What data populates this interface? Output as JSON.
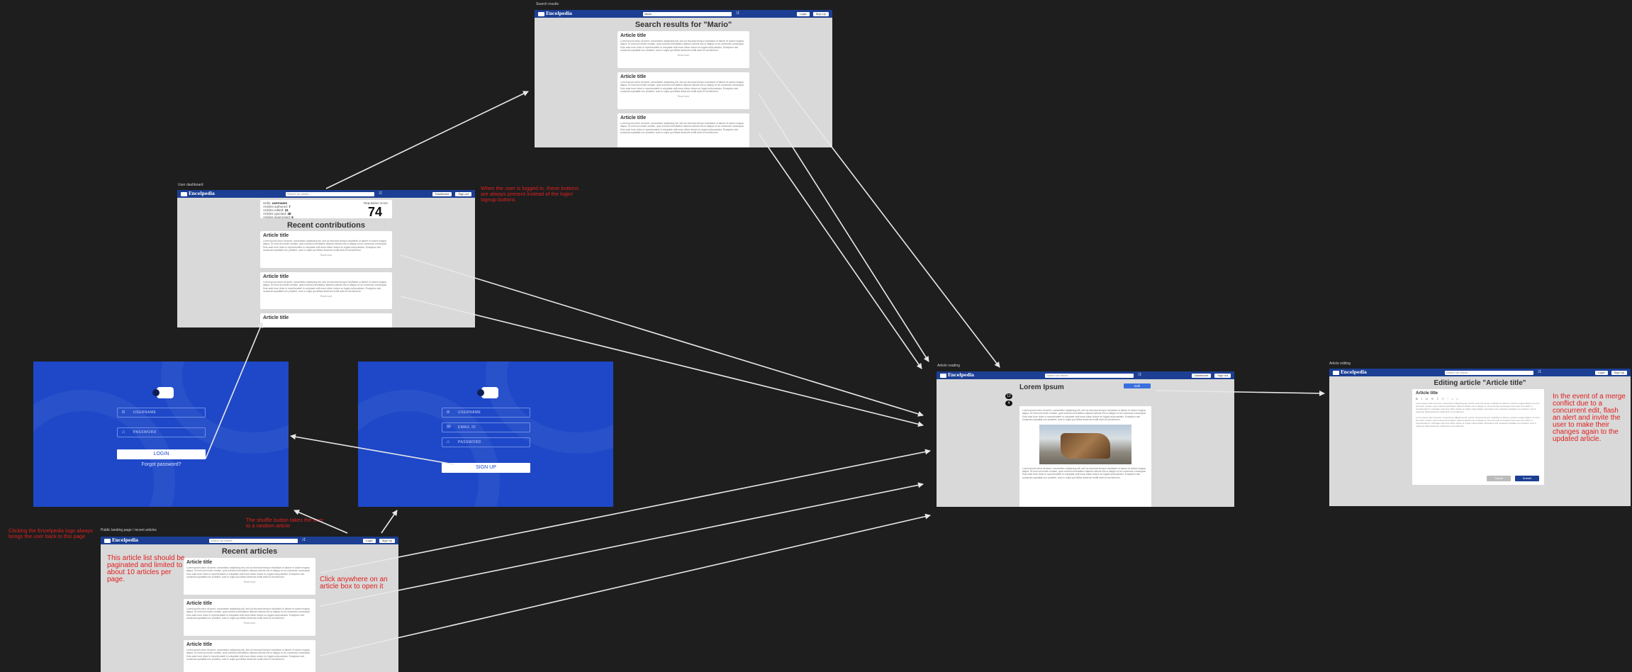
{
  "app": {
    "brand": "Encelpedia"
  },
  "frames": {
    "search": {
      "label": "Search results",
      "nav": {
        "search_value": "Mario",
        "login": "Login",
        "signup": "Sign Up"
      },
      "title": "Search results for \"Mario\"",
      "cards": [
        {
          "title": "Article title",
          "more": "Read more"
        },
        {
          "title": "Article title",
          "more": "Read more"
        },
        {
          "title": "Article title",
          "more": "Read more"
        }
      ]
    },
    "dashboard": {
      "label": "User dashboard",
      "nav": {
        "search_placeholder": "Search an article...",
        "dashboard": "Dashboard",
        "signout": "Sign out"
      },
      "user_label": "Hello, ",
      "user_name": "username",
      "stats": [
        {
          "label": "Articles authored: ",
          "value": "7"
        },
        {
          "label": "Articles edited: ",
          "value": "31"
        },
        {
          "label": "Articles upvoted: ",
          "value": "48"
        },
        {
          "label": "Articles downvoted: ",
          "value": "6"
        }
      ],
      "reputation_label": "Reputation score",
      "reputation_value": "74",
      "section_title": "Recent contributions",
      "cards": [
        {
          "title": "Article title",
          "more": "Read more"
        },
        {
          "title": "Article title",
          "more": "Read more"
        },
        {
          "title": "Article title",
          "more": ""
        }
      ]
    },
    "login": {
      "username": "USERNAME",
      "password": "PASSWORD",
      "button": "LOGIN",
      "forgot": "Forgot password?"
    },
    "signup": {
      "username": "USERNAME",
      "email": "EMAIL ID",
      "password": "PASSWORD",
      "button": "SIGN UP"
    },
    "landing": {
      "label": "Public landing page / recent articles",
      "nav": {
        "search_placeholder": "Search an article...",
        "login": "Login",
        "signup": "Sign Up"
      },
      "title": "Recent articles",
      "cards": [
        {
          "title": "Article title",
          "more": "Read more"
        },
        {
          "title": "Article title",
          "more": "Read more"
        },
        {
          "title": "Article title",
          "more": ""
        }
      ]
    },
    "reading": {
      "label": "Article reading",
      "nav": {
        "search_placeholder": "Search an article...",
        "dashboard": "Dashboard",
        "signout": "Sign out"
      },
      "title": "Lorem Ipsum",
      "edit": "Edit",
      "upvotes": "12",
      "downvotes": "4"
    },
    "editing": {
      "label": "Article editing",
      "nav": {
        "search_placeholder": "Search an article...",
        "login": "Login",
        "signup": "Sign Up"
      },
      "title": "Editing article \"Article title\"",
      "article_title": "Article title",
      "toolbar": "B I U S ≡ ≡ “ • •",
      "cancel": "Cancel",
      "submit": "Submit"
    }
  },
  "lorem": "Lorem ipsum dolor sit amet, consectetur adipiscing elit, sed do eiusmod tempor incididunt ut labore et dolore magna aliqua. Ut enim ad minim veniam, quis nostrud exercitation ullamco laboris nisi ut aliquip ex ea commodo consequat. Duis aute irure dolor in reprehenderit in voluptate velit esse cillum dolore eu fugiat nulla pariatur. Excepteur sint occaecat cupidatat non proident, sunt in culpa qui officia deserunt mollit anim id est laborum.",
  "notes": {
    "logged_in": "When the user is logged in, these buttons are always present instead of the login/ signup buttons",
    "logo": "Clicking the Encelpedia logo always brings the user back to this page",
    "shuffle": "The shuffle button takes the user to a random article",
    "pagination": "This article list should be paginated and limited to about 10 articles per page.",
    "click_box": "Click anywhere on an article box to open it",
    "merge": "In the event of a merge conflict due to a concurrent edit, flash an alert and invite the user to make their changes again to the updated article."
  }
}
